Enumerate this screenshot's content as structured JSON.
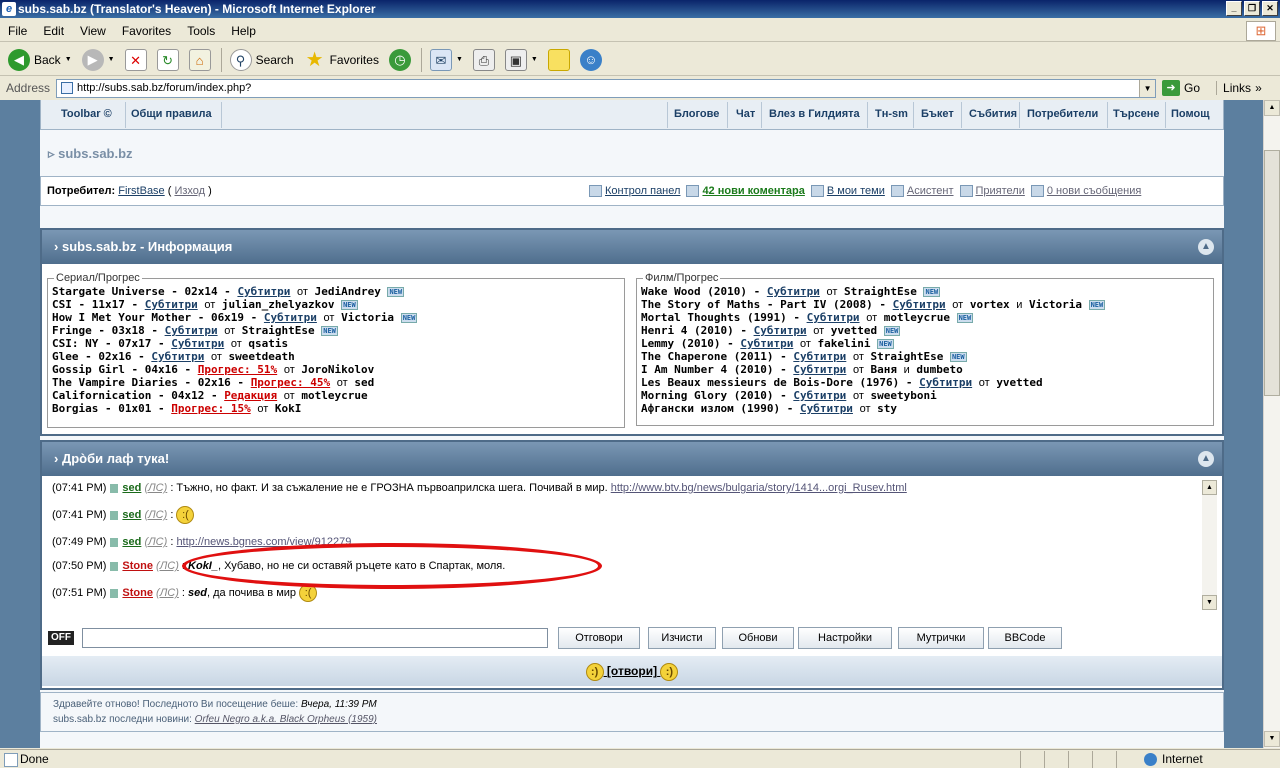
{
  "window": {
    "title": "subs.sab.bz (Translator's Heaven) - Microsoft Internet Explorer",
    "controls": [
      "_",
      "❐",
      "✕"
    ]
  },
  "menu": [
    "File",
    "Edit",
    "View",
    "Favorites",
    "Tools",
    "Help"
  ],
  "toolbar": {
    "back": "Back",
    "search": "Search",
    "favorites": "Favorites"
  },
  "address": {
    "label": "Address",
    "url": "http://subs.sab.bz/forum/index.php?",
    "go": "Go",
    "links": "Links"
  },
  "nav": {
    "left": [
      "Toolbar ©",
      "Общи правила"
    ],
    "right": [
      "Блогове",
      "Чат",
      "Влез в Гилдията",
      "Тн-sm",
      "Бъкет",
      "Събития",
      "Потребители",
      "Търсене",
      "Помощ"
    ]
  },
  "forum_title": "subs.sab.bz",
  "userbar": {
    "label": "Потребител:",
    "user": "FirstBase",
    "logout": "Изход",
    "links": [
      "Контрол панел",
      "42 нови коментара",
      "В мои теми",
      "Асистент",
      "Приятели",
      "0 нови съобщения"
    ]
  },
  "info": {
    "header": "subs.sab.bz - Информация",
    "series_legend": "Сериал/Прогрес",
    "movies_legend": "Филм/Прогрес",
    "of": "от",
    "and": "и",
    "series": [
      {
        "title": "Stargate Universe - 02x14 - ",
        "link": "Субтитри",
        "red": false,
        "by": "JediAndrey",
        "by2": "",
        "isnew": true
      },
      {
        "title": "CSI - 11x17 - ",
        "link": "Субтитри",
        "red": false,
        "by": "julian_zhelyazkov",
        "by2": "",
        "isnew": true
      },
      {
        "title": "How I Met Your Mother - 06x19 - ",
        "link": "Субтитри",
        "red": false,
        "by": "Victoria",
        "by2": "",
        "isnew": true
      },
      {
        "title": "Fringe - 03x18 - ",
        "link": "Субтитри",
        "red": false,
        "by": "StraightEse",
        "by2": "",
        "isnew": true
      },
      {
        "title": "CSI: NY - 07x17 - ",
        "link": "Субтитри",
        "red": false,
        "by": "qsatis",
        "by2": "",
        "isnew": false
      },
      {
        "title": "Glee - 02x16 - ",
        "link": "Субтитри",
        "red": false,
        "by": "sweetdeath",
        "by2": "",
        "isnew": false
      },
      {
        "title": "Gossip Girl - 04x16 - ",
        "link": "Прогрес: 51%",
        "red": true,
        "by": "JoroNikolov",
        "by2": "",
        "isnew": false
      },
      {
        "title": "The Vampire Diaries - 02x16 - ",
        "link": "Прогрес: 45%",
        "red": true,
        "by": "sed",
        "by2": "",
        "isnew": false
      },
      {
        "title": "Californication - 04x12 - ",
        "link": "Редакция",
        "red": true,
        "by": "motleycrue",
        "by2": "",
        "isnew": false
      },
      {
        "title": "Borgias - 01x01 - ",
        "link": "Прогрес: 15%",
        "red": true,
        "by": "KokI",
        "by2": "",
        "isnew": false
      }
    ],
    "movies": [
      {
        "title": "Wake Wood (2010) - ",
        "link": "Субтитри",
        "red": false,
        "by": "StraightEse",
        "by2": "",
        "isnew": true
      },
      {
        "title": "The Story of Maths - Part IV (2008) - ",
        "link": "Субтитри",
        "red": false,
        "by": "vortex",
        "by2": "Victoria",
        "isnew": true
      },
      {
        "title": "Mortal Thoughts (1991) - ",
        "link": "Субтитри",
        "red": false,
        "by": "motleycrue",
        "by2": "",
        "isnew": true
      },
      {
        "title": "Henri 4 (2010) - ",
        "link": "Субтитри",
        "red": false,
        "by": "yvetted",
        "by2": "",
        "isnew": true
      },
      {
        "title": "Lemmy (2010) - ",
        "link": "Субтитри",
        "red": false,
        "by": "fakelini",
        "by2": "",
        "isnew": true
      },
      {
        "title": "The Chaperone (2011) - ",
        "link": "Субтитри",
        "red": false,
        "by": "StraightEse",
        "by2": "",
        "isnew": true
      },
      {
        "title": "I Am Number 4 (2010) - ",
        "link": "Субтитри",
        "red": false,
        "by": "Ваня",
        "by2": "dumbeto",
        "isnew": false
      },
      {
        "title": "Les Beaux messieurs de Bois-Dore (1976) - ",
        "link": "Субтитри",
        "red": false,
        "by": "yvetted",
        "by2": "",
        "isnew": false
      },
      {
        "title": "Morning Glory (2010) - ",
        "link": "Субтитри",
        "red": false,
        "by": "sweetyboni",
        "by2": "",
        "isnew": false
      },
      {
        "title": "Афгански излом (1990) - ",
        "link": "Субтитри",
        "red": false,
        "by": "sty",
        "by2": "",
        "isnew": false
      }
    ]
  },
  "chat": {
    "header": "Дрòби лаф тука!",
    "ls": "(ЛС)",
    "messages": [
      {
        "time": "(07:41 PM)",
        "user": "sed",
        "color": "#1a6a1a",
        "text": " : Тъжно, но факт. И за съжаление не е ГРОЗНА първоаприлска шега. Почивай в мир. ",
        "url": "http://www.btv.bg/news/bulgaria/story/1414...orgi_Rusev.html",
        "nick": "",
        "smile": false
      },
      {
        "time": "(07:41 PM)",
        "user": "sed",
        "color": "#1a6a1a",
        "text": " : ",
        "url": "",
        "nick": "",
        "smile": true
      },
      {
        "time": "(07:49 PM)",
        "user": "sed",
        "color": "#1a6a1a",
        "text": " : ",
        "url": "http://news.bgnes.com/view/912279",
        "nick": "",
        "smile": false
      },
      {
        "time": "(07:50 PM)",
        "user": "Stone",
        "color": "#c01010",
        "text": ", Хубаво, но не си оставяй ръцете като в Спартак, моля.",
        "url": "",
        "nick": "KokI_",
        "smile": false
      },
      {
        "time": "(07:51 PM)",
        "user": "Stone",
        "color": "#c01010",
        "text": ", да почива в мир ",
        "url": "",
        "nick": "sed",
        "smile": true
      }
    ],
    "off": "OFF",
    "buttons": [
      "Отговори",
      "Изчисти",
      "Обнови",
      "Настройки",
      "Мутрички",
      "BBCode"
    ],
    "footer": "[отвори]"
  },
  "footer": {
    "welcome": "Здравейте отново! Последното Ви посещение беше: ",
    "last_visit": "Вчера, 11:39 PM",
    "news_label": "subs.sab.bz последни новини: ",
    "news": "Orfeu Negro a.k.a. Black Orpheus (1959)"
  },
  "status": {
    "text": "Done",
    "zone": "Internet"
  },
  "colors": {
    "titlebar": "#0a246a",
    "header": "#4f6e8d",
    "annotation": "#e01010"
  }
}
